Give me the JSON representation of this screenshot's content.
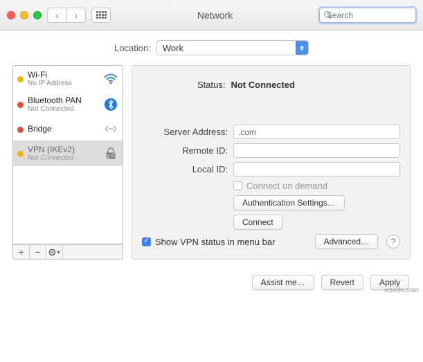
{
  "window": {
    "title": "Network",
    "search_placeholder": "Search"
  },
  "location": {
    "label": "Location:",
    "value": "Work"
  },
  "services": [
    {
      "name": "Wi-Fi",
      "sub": "No IP Address",
      "status": "yellow",
      "icon": "wifi"
    },
    {
      "name": "Bluetooth PAN",
      "sub": "Not Connected",
      "status": "red",
      "icon": "bluetooth"
    },
    {
      "name": "Bridge",
      "sub": "",
      "status": "red",
      "icon": "bridge"
    },
    {
      "name": "VPN (IKEv2)",
      "sub": "Not Connected",
      "status": "yellow",
      "icon": "vpn",
      "selected": true
    }
  ],
  "detail": {
    "status_label": "Status:",
    "status_value": "Not Connected",
    "server_address_label": "Server Address:",
    "server_address_value": ".com",
    "remote_id_label": "Remote ID:",
    "remote_id_value": "",
    "local_id_label": "Local ID:",
    "local_id_value": "",
    "connect_on_demand": "Connect on demand",
    "auth_settings": "Authentication Settings…",
    "connect": "Connect",
    "show_status": "Show VPN status in menu bar",
    "advanced": "Advanced…"
  },
  "footer": {
    "assist": "Assist me…",
    "revert": "Revert",
    "apply": "Apply"
  },
  "watermark": "wsxdn.com"
}
